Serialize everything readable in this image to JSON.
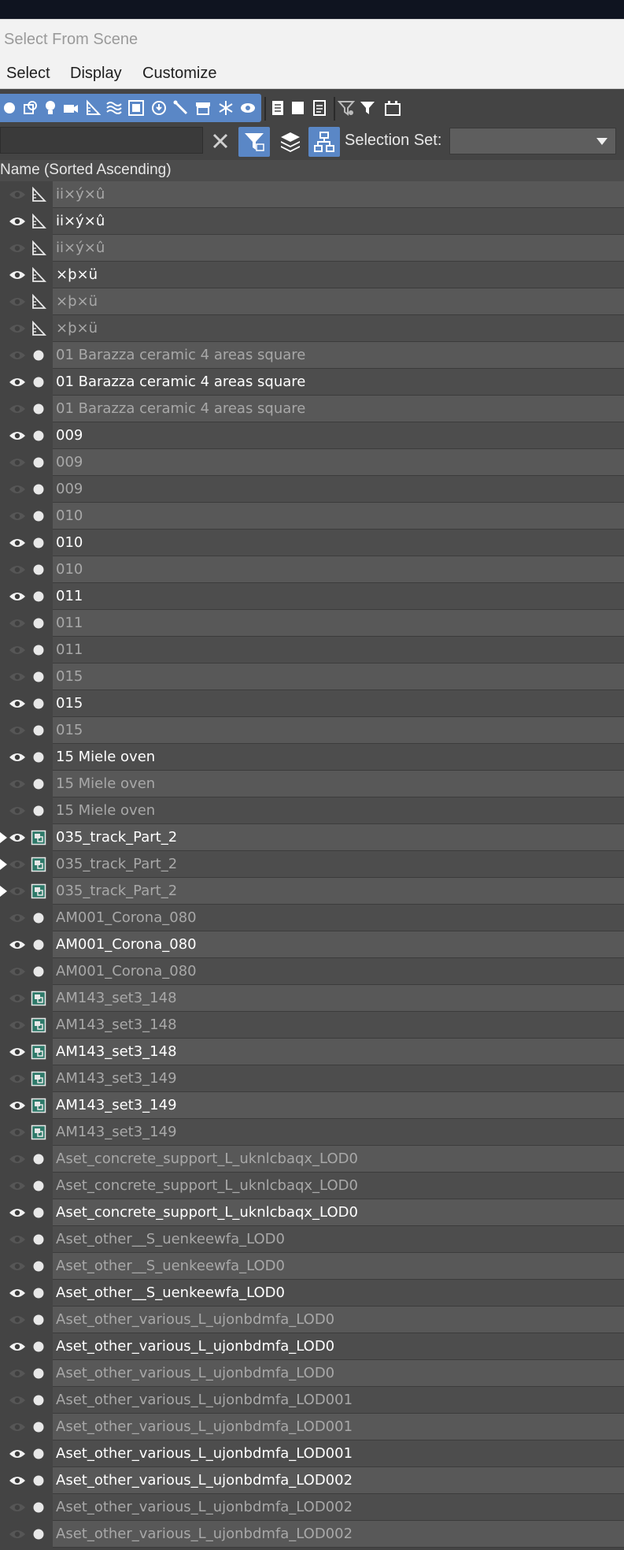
{
  "window": {
    "title": "Select From Scene"
  },
  "menu": {
    "items": [
      "Select",
      "Display",
      "Customize"
    ]
  },
  "toolbar": {
    "filter_icons": [
      "geometry-circle-icon",
      "shape-icon",
      "light-icon",
      "camera-icon",
      "helper-icon",
      "spacewarp-icon",
      "group-icon",
      "xref-icon",
      "bone-icon",
      "container-icon",
      "frozen-icon",
      "hidden-icon"
    ],
    "list_icons": [
      "display-all-icon",
      "display-none-icon",
      "display-invert-icon"
    ],
    "filter_extra_icons": [
      "filter-settings-icon",
      "filter-icon",
      "layer-folder-icon"
    ]
  },
  "search": {
    "value": "",
    "placeholder": ""
  },
  "selection_set": {
    "label": "Selection Set:",
    "value": ""
  },
  "list": {
    "header": "Name (Sorted Ascending)",
    "rows": [
      {
        "name": "ii×ý×û",
        "visible": false,
        "type": "helper",
        "expand": false
      },
      {
        "name": "ii×ý×û",
        "visible": true,
        "type": "helper",
        "expand": false
      },
      {
        "name": "ii×ý×û",
        "visible": false,
        "type": "helper",
        "expand": false
      },
      {
        "name": "×þ×ü",
        "visible": true,
        "type": "helper",
        "expand": false
      },
      {
        "name": "×þ×ü",
        "visible": false,
        "type": "helper",
        "expand": false
      },
      {
        "name": "×þ×ü",
        "visible": false,
        "type": "helper",
        "expand": false
      },
      {
        "name": "01 Barazza ceramic 4 areas square",
        "visible": false,
        "type": "geometry",
        "expand": false
      },
      {
        "name": "01 Barazza ceramic 4 areas square",
        "visible": true,
        "type": "geometry",
        "expand": false
      },
      {
        "name": "01 Barazza ceramic 4 areas square",
        "visible": false,
        "type": "geometry",
        "expand": false
      },
      {
        "name": "009",
        "visible": true,
        "type": "geometry",
        "expand": false
      },
      {
        "name": "009",
        "visible": false,
        "type": "geometry",
        "expand": false
      },
      {
        "name": "009",
        "visible": false,
        "type": "geometry",
        "expand": false
      },
      {
        "name": "010",
        "visible": false,
        "type": "geometry",
        "expand": false
      },
      {
        "name": "010",
        "visible": true,
        "type": "geometry",
        "expand": false
      },
      {
        "name": "010",
        "visible": false,
        "type": "geometry",
        "expand": false
      },
      {
        "name": "011",
        "visible": true,
        "type": "geometry",
        "expand": false
      },
      {
        "name": "011",
        "visible": false,
        "type": "geometry",
        "expand": false
      },
      {
        "name": "011",
        "visible": false,
        "type": "geometry",
        "expand": false
      },
      {
        "name": "015",
        "visible": false,
        "type": "geometry",
        "expand": false
      },
      {
        "name": "015",
        "visible": true,
        "type": "geometry",
        "expand": false
      },
      {
        "name": "015",
        "visible": false,
        "type": "geometry",
        "expand": false
      },
      {
        "name": "15 Miele oven",
        "visible": true,
        "type": "geometry",
        "expand": false
      },
      {
        "name": "15 Miele oven",
        "visible": false,
        "type": "geometry",
        "expand": false
      },
      {
        "name": "15 Miele oven",
        "visible": false,
        "type": "geometry",
        "expand": false
      },
      {
        "name": "035_track_Part_2",
        "visible": true,
        "type": "group",
        "expand": true
      },
      {
        "name": "035_track_Part_2",
        "visible": false,
        "type": "group",
        "expand": true
      },
      {
        "name": "035_track_Part_2",
        "visible": false,
        "type": "group",
        "expand": true
      },
      {
        "name": "AM001_Corona_080",
        "visible": false,
        "type": "geometry",
        "expand": false
      },
      {
        "name": "AM001_Corona_080",
        "visible": true,
        "type": "geometry",
        "expand": false
      },
      {
        "name": "AM001_Corona_080",
        "visible": false,
        "type": "geometry",
        "expand": false
      },
      {
        "name": "AM143_set3_148",
        "visible": false,
        "type": "group",
        "expand": false
      },
      {
        "name": "AM143_set3_148",
        "visible": false,
        "type": "group",
        "expand": false
      },
      {
        "name": "AM143_set3_148",
        "visible": true,
        "type": "group",
        "expand": false
      },
      {
        "name": "AM143_set3_149",
        "visible": false,
        "type": "group",
        "expand": false
      },
      {
        "name": "AM143_set3_149",
        "visible": true,
        "type": "group",
        "expand": false
      },
      {
        "name": "AM143_set3_149",
        "visible": false,
        "type": "group",
        "expand": false
      },
      {
        "name": "Aset_concrete_support_L_uknlcbaqx_LOD0",
        "visible": false,
        "type": "geometry",
        "expand": false
      },
      {
        "name": "Aset_concrete_support_L_uknlcbaqx_LOD0",
        "visible": false,
        "type": "geometry",
        "expand": false
      },
      {
        "name": "Aset_concrete_support_L_uknlcbaqx_LOD0",
        "visible": true,
        "type": "geometry",
        "expand": false
      },
      {
        "name": "Aset_other__S_uenkeewfa_LOD0",
        "visible": false,
        "type": "geometry",
        "expand": false
      },
      {
        "name": "Aset_other__S_uenkeewfa_LOD0",
        "visible": false,
        "type": "geometry",
        "expand": false
      },
      {
        "name": "Aset_other__S_uenkeewfa_LOD0",
        "visible": true,
        "type": "geometry",
        "expand": false
      },
      {
        "name": "Aset_other_various_L_ujonbdmfa_LOD0",
        "visible": false,
        "type": "geometry",
        "expand": false
      },
      {
        "name": "Aset_other_various_L_ujonbdmfa_LOD0",
        "visible": true,
        "type": "geometry",
        "expand": false
      },
      {
        "name": "Aset_other_various_L_ujonbdmfa_LOD0",
        "visible": false,
        "type": "geometry",
        "expand": false
      },
      {
        "name": "Aset_other_various_L_ujonbdmfa_LOD001",
        "visible": false,
        "type": "geometry",
        "expand": false
      },
      {
        "name": "Aset_other_various_L_ujonbdmfa_LOD001",
        "visible": false,
        "type": "geometry",
        "expand": false
      },
      {
        "name": "Aset_other_various_L_ujonbdmfa_LOD001",
        "visible": true,
        "type": "geometry",
        "expand": false
      },
      {
        "name": "Aset_other_various_L_ujonbdmfa_LOD002",
        "visible": true,
        "type": "geometry",
        "expand": false
      },
      {
        "name": "Aset_other_various_L_ujonbdmfa_LOD002",
        "visible": false,
        "type": "geometry",
        "expand": false
      },
      {
        "name": "Aset_other_various_L_ujonbdmfa_LOD002",
        "visible": false,
        "type": "geometry",
        "expand": false
      }
    ]
  },
  "colors": {
    "accent": "#5a87c6",
    "panel": "#444444",
    "row_even": "#585858",
    "row_odd": "#4d4d4d"
  }
}
